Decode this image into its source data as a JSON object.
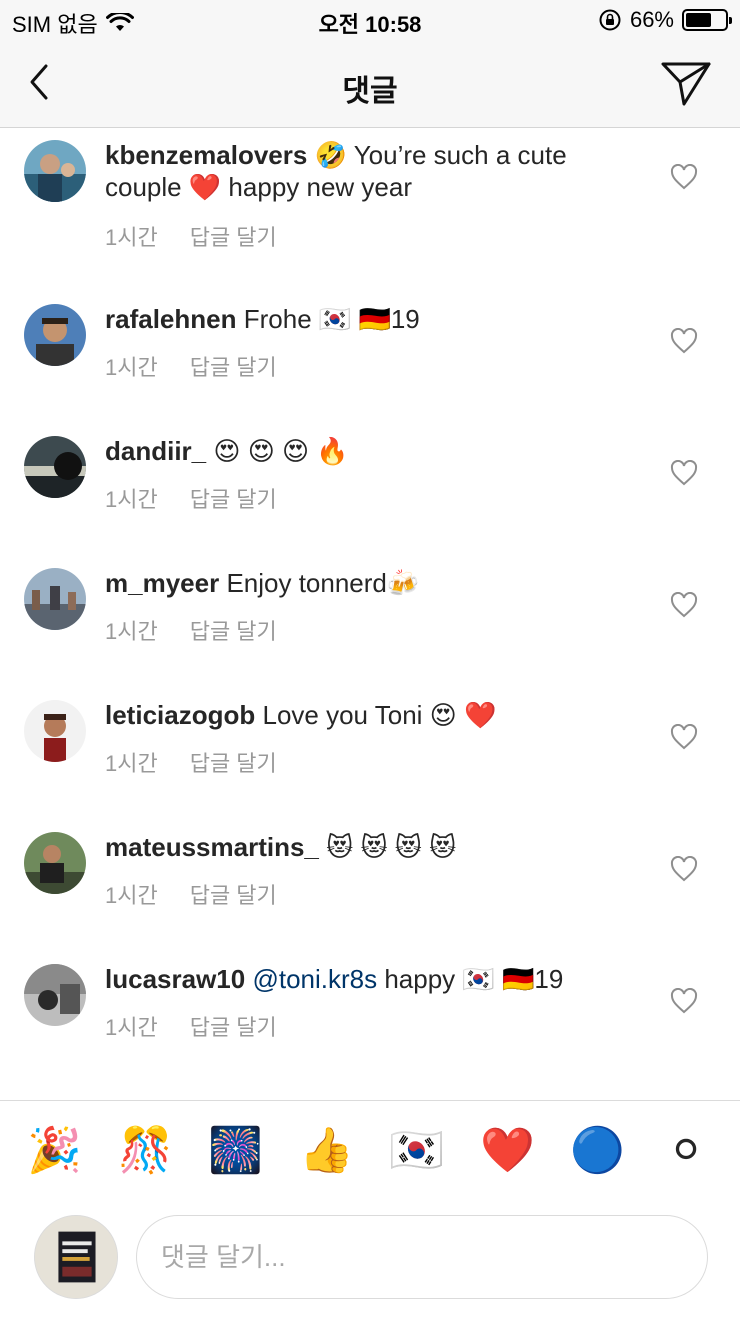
{
  "status_bar": {
    "carrier": "SIM 없음",
    "time": "오전 10:58",
    "battery_percent": "66%",
    "battery_level": 0.66
  },
  "nav": {
    "title": "댓글",
    "back_icon": "chevron-left-icon",
    "send_icon": "paper-plane-icon"
  },
  "comments": [
    {
      "username": "kbenzemalovers",
      "line1": "🤣 You’re such a cute",
      "line2": "couple ❤️ happy new year",
      "time": "1시간",
      "reply": "답글 달기"
    },
    {
      "username": "rafalehnen",
      "text": "Frohe 🇰🇷 🇩🇪19",
      "time": "1시간",
      "reply": "답글 달기"
    },
    {
      "username": "dandiir_",
      "text": "😍 😍 😍 🔥",
      "time": "1시간",
      "reply": "답글 달기"
    },
    {
      "username": "m_myeer",
      "text": "Enjoy tonnerd🍻",
      "time": "1시간",
      "reply": "답글 달기"
    },
    {
      "username": "leticiazogob",
      "text": "Love you Toni 😍 ❤️",
      "time": "1시간",
      "reply": "답글 달기"
    },
    {
      "username": "mateussmartins_",
      "text": "😻 😻 😻 😻",
      "time": "1시간",
      "reply": "답글 달기"
    },
    {
      "username": "lucasraw10",
      "mention": "@toni.kr8s",
      "text": " happy 🇰🇷 🇩🇪19",
      "time": "1시간",
      "reply": "답글 달기"
    }
  ],
  "emoji_bar": [
    "🎉",
    "🎊",
    "🎆",
    "👍",
    "🇰🇷",
    "❤️",
    "🔵",
    "⚪"
  ],
  "composer": {
    "placeholder": "댓글 달기..."
  },
  "colors": {
    "bar_background": "#f7f7f7",
    "text": "#262626",
    "meta": "#999999",
    "mention": "#003569",
    "divider": "#dbdbdb"
  }
}
